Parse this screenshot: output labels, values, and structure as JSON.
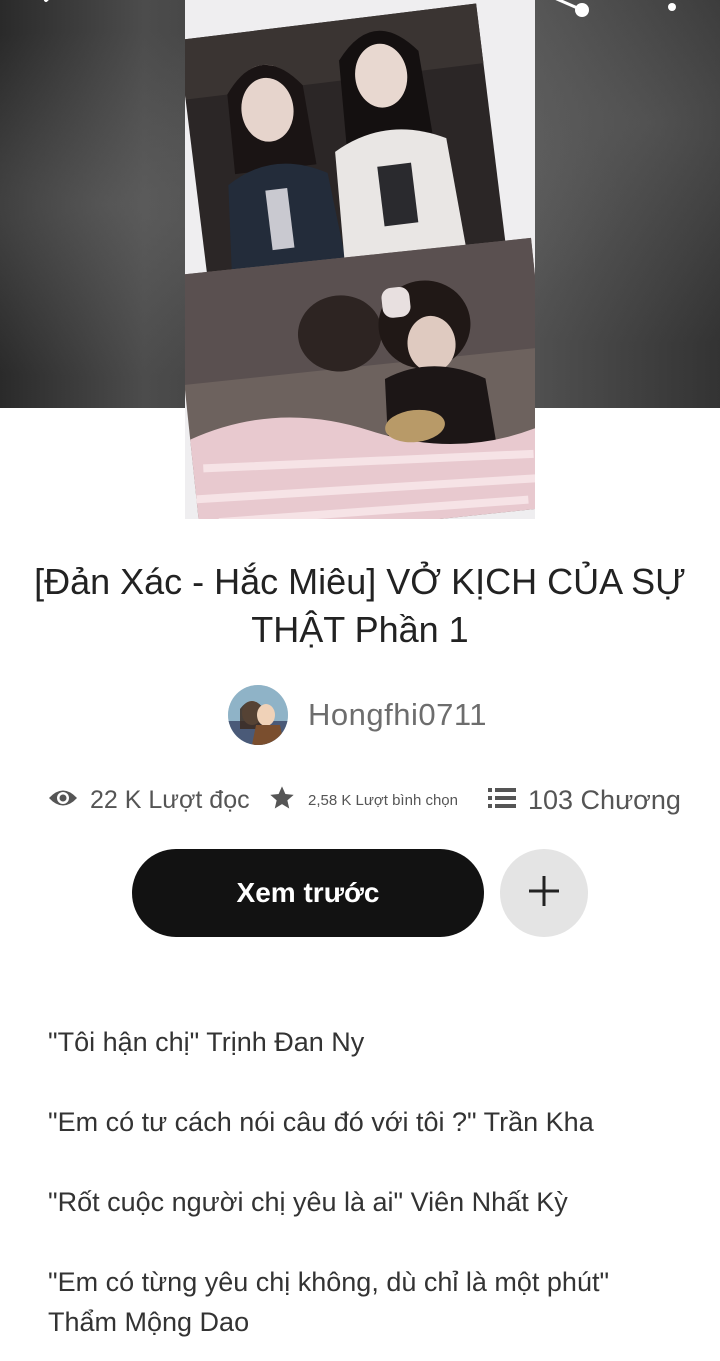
{
  "story": {
    "title": "[Đản Xác - Hắc Miêu] VỞ KỊCH CỦA SỰ THẬT Phần 1",
    "author": "Hongfhi0711",
    "stats": {
      "reads": "22 K Lượt đọc",
      "votes": "2,58 K Lượt bình chọn",
      "parts": "103 Chương"
    }
  },
  "actions": {
    "preview_label": "Xem trước",
    "add_icon": "plus-icon"
  },
  "header_icons": [
    "back-icon",
    "share-icon",
    "more-icon"
  ],
  "description": [
    "\"Tôi hận chị\" Trịnh Đan Ny",
    "\"Em có tư cách nói câu đó với tôi ?\" Trần Kha",
    "\"Rốt cuộc người chị yêu là ai\" Viên Nhất Kỳ",
    "\"Em có từng yêu chị không, dù chỉ là một phút\" Thẩm Mộng Dao"
  ],
  "colors": {
    "button_primary": "#121212",
    "button_secondary": "#e4e4e4",
    "text_muted": "#6d6d6d"
  }
}
